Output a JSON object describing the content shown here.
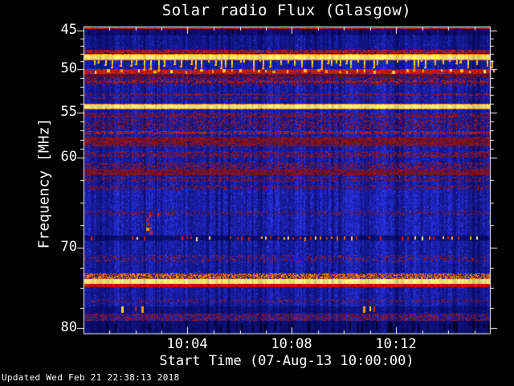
{
  "chart_data": {
    "type": "heatmap",
    "title": "Solar radio Flux (Glasgow)",
    "xlabel": "Start Time (07-Aug-13 10:00:00)",
    "ylabel": "Frequency [MHz]",
    "x_tick_labels": [
      "10:04",
      "10:08",
      "10:12"
    ],
    "x_tick_minutes": [
      4,
      8,
      12
    ],
    "x_minor_tick_minutes": 1,
    "x_range_minutes": [
      0,
      15.6
    ],
    "y_tick_labels": [
      "45",
      "50",
      "55",
      "60",
      "70",
      "80"
    ],
    "y_tick_values_mhz": [
      45,
      50,
      55,
      60,
      70,
      80
    ],
    "y_range_mhz": [
      44.5,
      80.7
    ],
    "y_axis_direction": "frequency increases downward",
    "updated_text": "Updated Wed Feb 21 22:38:13 2018",
    "legend_position": "none",
    "grid": false,
    "palette": {
      "background": "#000000",
      "axis_and_text": "#ffffff",
      "quiet_blue": "#2a34eb",
      "deep_blue": "#000040",
      "moderate_red": "#cc1505",
      "dark_red": "#7a0f1f",
      "strong_orange": "#ff9a18",
      "saturated_yellow": "#f6e87a",
      "peak_gold": "#ffc428"
    },
    "rfi_bands": [
      {
        "f0": 44.45,
        "f1": 44.8,
        "style": "red_mottle",
        "p": 0.8
      },
      {
        "f0": 44.8,
        "f1": 45.6,
        "style": "dim",
        "mult": 0.5
      },
      {
        "f0": 45.6,
        "f1": 47.5,
        "style": "dim",
        "mult": 0.8
      },
      {
        "f0": 47.5,
        "f1": 47.9,
        "style": "red_mottle",
        "p": 0.55
      },
      {
        "f0": 48.05,
        "f1": 48.17,
        "style": "orange_edge"
      },
      {
        "f0": 48.17,
        "f1": 48.72,
        "style": "yellow"
      },
      {
        "f0": 48.72,
        "f1": 48.85,
        "style": "orange_edge"
      },
      {
        "f0": 50.0,
        "f1": 50.55,
        "style": "red_mottle",
        "p": 0.85
      },
      {
        "f0": 50.55,
        "f1": 50.95,
        "style": "dark_red"
      },
      {
        "f0": 50.95,
        "f1": 51.3,
        "style": "purple",
        "p": 0.35
      },
      {
        "f0": 51.3,
        "f1": 51.55,
        "style": "red_mottle",
        "p": 0.45
      },
      {
        "f0": 51.55,
        "f1": 51.9,
        "style": "purple",
        "p": 0.28
      },
      {
        "f0": 52.8,
        "f1": 53.05,
        "style": "purple",
        "p": 0.5
      },
      {
        "f0": 53.2,
        "f1": 53.45,
        "style": "purple",
        "p": 0.42
      },
      {
        "f0": 54.0,
        "f1": 54.12,
        "style": "orange_edge"
      },
      {
        "f0": 54.12,
        "f1": 54.5,
        "style": "yellow"
      },
      {
        "f0": 54.5,
        "f1": 54.62,
        "style": "orange_edge"
      },
      {
        "f0": 55.0,
        "f1": 55.65,
        "style": "purple",
        "p": 0.5
      },
      {
        "f0": 55.75,
        "f1": 56.85,
        "style": "purple",
        "p": 0.3
      },
      {
        "f0": 57.05,
        "f1": 57.4,
        "style": "red_mottle",
        "p": 0.55
      },
      {
        "f0": 57.7,
        "f1": 58.75,
        "style": "dark_red_strong"
      },
      {
        "f0": 59.3,
        "f1": 60.0,
        "style": "purple",
        "p": 0.45
      },
      {
        "f0": 60.55,
        "f1": 61.25,
        "style": "purple",
        "p": 0.4
      },
      {
        "f0": 61.25,
        "f1": 61.95,
        "style": "dark_red_strong"
      },
      {
        "f0": 62.15,
        "f1": 62.7,
        "style": "purple",
        "p": 0.35
      },
      {
        "f0": 63.05,
        "f1": 63.6,
        "style": "purple",
        "p": 0.3
      },
      {
        "f0": 63.6,
        "f1": 68.6,
        "style": "bright",
        "mult": 1.12
      },
      {
        "f0": 65.9,
        "f1": 66.45,
        "style": "purple",
        "p": 0.22
      },
      {
        "f0": 68.65,
        "f1": 69.2,
        "style": "dim",
        "mult": 0.45
      },
      {
        "f0": 70.9,
        "f1": 71.8,
        "style": "speckle",
        "p": 0.16
      },
      {
        "f0": 73.2,
        "f1": 73.9,
        "style": "orange_mottle"
      },
      {
        "f0": 73.9,
        "f1": 74.5,
        "style": "yellow"
      },
      {
        "f0": 74.5,
        "f1": 74.9,
        "style": "red_line"
      },
      {
        "f0": 76.4,
        "f1": 76.8,
        "style": "purple",
        "p": 0.25
      },
      {
        "f0": 77.3,
        "f1": 78.2,
        "style": "dim",
        "mult": 0.62
      },
      {
        "f0": 78.2,
        "f1": 79.1,
        "style": "purple",
        "p": 0.42
      },
      {
        "f0": 79.1,
        "f1": 80.72,
        "style": "dim",
        "mult": 0.5
      }
    ],
    "features": {
      "drip_spikes": {
        "f_start_mhz": 48.85,
        "f_end_max_mhz": 50.0,
        "description": "intermittent yellow RFI spikes hanging below the 48.5 MHz carrier"
      },
      "blob_band": {
        "f0": 50.0,
        "f1": 50.55,
        "description": "red RFI band peppered with yellow/orange blobs"
      },
      "dash_row": {
        "f0": 68.72,
        "f1": 69.15,
        "dense_minutes": [
          5.4,
          11.0
        ],
        "medium_minutes": [
          11.0,
          15.6
        ],
        "sparse_times_min": [
          0.25,
          1.95,
          2.25,
          3.75,
          3.95,
          4.2
        ],
        "description": "row of regularly spaced orange/red dashes"
      },
      "burst": {
        "time_min": 2.45,
        "f0_mhz": 66.0,
        "f1_mhz": 68.3,
        "description": "short vertical chain of red burst dashes with bright orange core"
      },
      "bright_dashes": {
        "f0": 77.35,
        "f1": 78.1,
        "events": [
          {
            "t_min": 1.42,
            "color": "#ffd040"
          },
          {
            "t_min": 1.95,
            "color": "#d02010"
          },
          {
            "t_min": 2.2,
            "color": "#ff9a18"
          },
          {
            "t_min": 10.7,
            "color": "#ff9a18"
          },
          {
            "t_min": 10.95,
            "color": "#ffd040"
          },
          {
            "t_min": 11.1,
            "color": "#d02010"
          }
        ]
      }
    }
  }
}
